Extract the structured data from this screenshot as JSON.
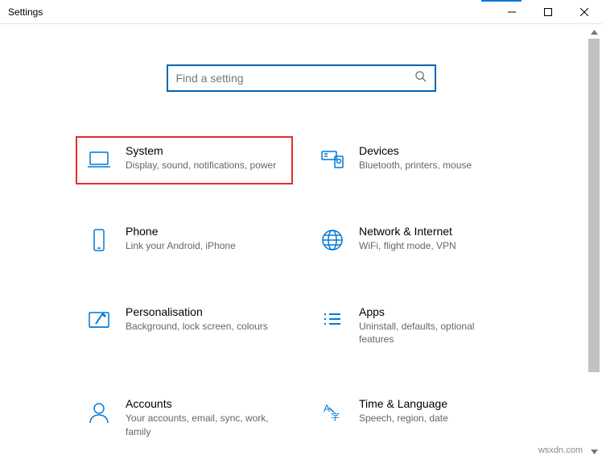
{
  "window": {
    "title": "Settings"
  },
  "search": {
    "placeholder": "Find a setting"
  },
  "categories": [
    {
      "id": "system",
      "title": "System",
      "desc": "Display, sound, notifications, power",
      "highlighted": true,
      "icon": "laptop-icon"
    },
    {
      "id": "devices",
      "title": "Devices",
      "desc": "Bluetooth, printers, mouse",
      "highlighted": false,
      "icon": "devices-icon"
    },
    {
      "id": "phone",
      "title": "Phone",
      "desc": "Link your Android, iPhone",
      "highlighted": false,
      "icon": "phone-icon"
    },
    {
      "id": "network",
      "title": "Network & Internet",
      "desc": "WiFi, flight mode, VPN",
      "highlighted": false,
      "icon": "globe-icon"
    },
    {
      "id": "personalisation",
      "title": "Personalisation",
      "desc": "Background, lock screen, colours",
      "highlighted": false,
      "icon": "personalise-icon"
    },
    {
      "id": "apps",
      "title": "Apps",
      "desc": "Uninstall, defaults, optional features",
      "highlighted": false,
      "icon": "apps-icon"
    },
    {
      "id": "accounts",
      "title": "Accounts",
      "desc": "Your accounts, email, sync, work, family",
      "highlighted": false,
      "icon": "person-icon"
    },
    {
      "id": "time-language",
      "title": "Time & Language",
      "desc": "Speech, region, date",
      "highlighted": false,
      "icon": "time-language-icon"
    }
  ],
  "colors": {
    "accent": "#0078d7",
    "highlight_border": "#e82a2a"
  },
  "watermark": "wsxdn.com"
}
